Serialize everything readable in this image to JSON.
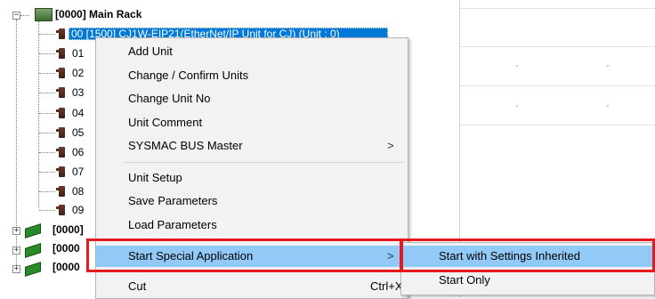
{
  "tree": {
    "main_rack_label": "[0000] Main Rack",
    "selected_slot_label": "00 [1500] CJ1W-EIP21(EtherNet/IP Unit for CJ) (Unit : 0)",
    "slots": [
      "01",
      "02",
      "03",
      "04",
      "05",
      "06",
      "07",
      "08",
      "09"
    ],
    "other_racks": [
      "[0000]",
      "[0000",
      "[0000"
    ]
  },
  "context_menu": {
    "items": [
      {
        "label": "Add Unit"
      },
      {
        "label": "Change / Confirm Units"
      },
      {
        "label": "Change Unit No"
      },
      {
        "label": "Unit Comment"
      },
      {
        "label": "SYSMAC BUS Master",
        "arrow": ">"
      },
      {
        "label": "Unit Setup"
      },
      {
        "label": "Save Parameters"
      },
      {
        "label": "Load Parameters"
      },
      {
        "label": "Start Special Application",
        "arrow": ">"
      },
      {
        "label": "Cut",
        "shortcut": "Ctrl+X"
      }
    ]
  },
  "submenu": {
    "items": [
      {
        "label": "Start with Settings Inherited"
      },
      {
        "label": "Start Only"
      }
    ]
  },
  "colors": {
    "selection": "#0078d7",
    "menu_highlight": "#91c9f7",
    "annotation_red": "#e8191e"
  },
  "icons": {
    "expander_expanded": "minus-box",
    "expander_collapsed": "plus-box",
    "slot": "unit-slot-icon",
    "rack": "green-rack-icon",
    "submenu_arrow": "chevron-right"
  }
}
